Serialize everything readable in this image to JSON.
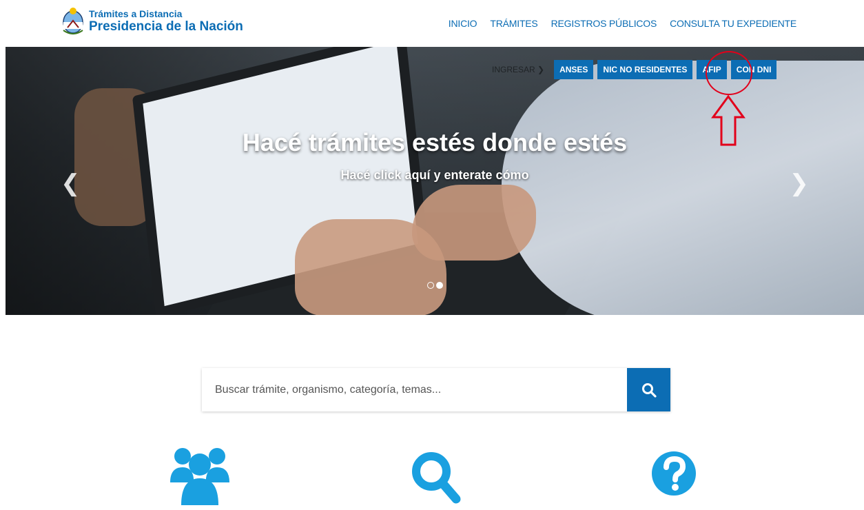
{
  "logo": {
    "line1": "Trámites a Distancia",
    "line2": "Presidencia de la Nación"
  },
  "nav": [
    "INICIO",
    "TRÁMITES",
    "REGISTROS PÚBLICOS",
    "CONSULTA TU EXPEDIENTE"
  ],
  "login": {
    "label": "INGRESAR",
    "buttons": [
      "ANSES",
      "NIC NO RESIDENTES",
      "AFIP",
      "CON DNI"
    ]
  },
  "hero": {
    "title": "Hacé trámites estés donde estés",
    "subtitle": "Hacé click aquí y enterate cómo"
  },
  "search": {
    "placeholder": "Buscar trámite, organismo, categoría, temas..."
  },
  "colors": {
    "brand_blue": "#0c6db4",
    "icon_blue": "#1aa0e0",
    "annotation_red": "#e2001a"
  },
  "carousel": {
    "slides": 2,
    "active_slide": 2
  },
  "features": [
    {
      "icon": "users-icon"
    },
    {
      "icon": "search-icon"
    },
    {
      "icon": "question-icon"
    }
  ]
}
